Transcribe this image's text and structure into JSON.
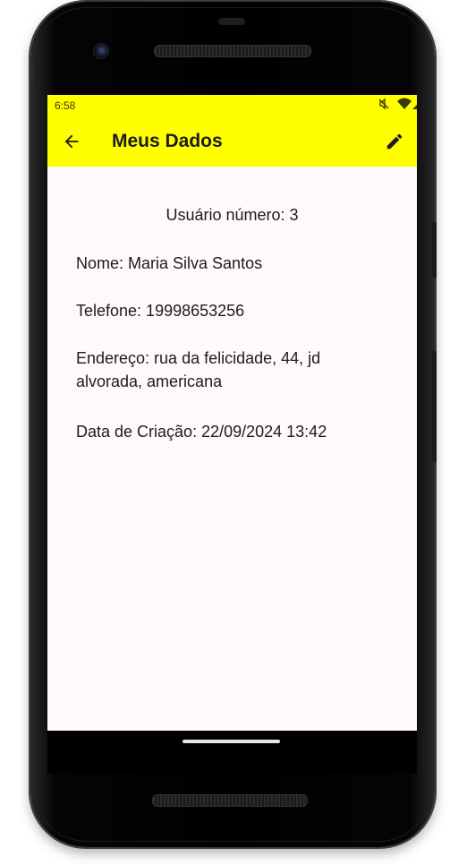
{
  "status_bar": {
    "time": "6:58",
    "icons": [
      "mute-icon",
      "wifi-icon",
      "signal-icon"
    ]
  },
  "app_bar": {
    "title": "Meus Dados",
    "background_color": "#ffff00",
    "back_icon": "arrow-back-icon",
    "edit_icon": "pencil-icon"
  },
  "user": {
    "number_label": "Usuário número: 3",
    "nome": "Nome: Maria Silva Santos",
    "telefone": "Telefone: 19998653256",
    "endereco": "Endereço: rua da felicidade,  44, jd alvorada, americana",
    "data_criacao": "Data de Criação: 22/09/2024 13:42"
  }
}
